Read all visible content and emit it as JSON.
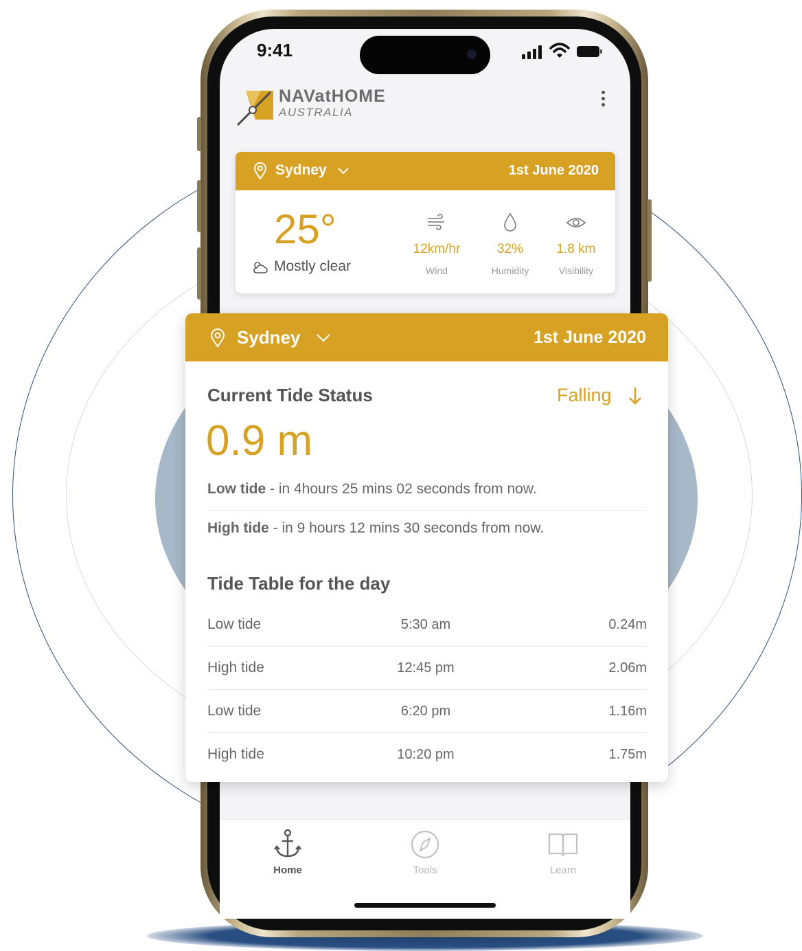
{
  "status_bar": {
    "time": "9:41"
  },
  "brand": {
    "name": "NAVatHOME",
    "subtitle": "AUSTRALIA"
  },
  "weather_card": {
    "location": "Sydney",
    "date": "1st June 2020",
    "temperature": "25°",
    "condition": "Mostly clear",
    "stats": [
      {
        "icon": "wind-icon",
        "value": "12km/hr",
        "label": "Wind"
      },
      {
        "icon": "droplet-icon",
        "value": "32%",
        "label": "Humidity"
      },
      {
        "icon": "eye-icon",
        "value": "1.8 km",
        "label": "Visibility"
      }
    ]
  },
  "tide_card": {
    "location": "Sydney",
    "date": "1st June 2020",
    "status_title": "Current Tide Status",
    "trend": "Falling",
    "current_height": "0.9 m",
    "next_low": {
      "label": "Low tide",
      "text": " - in 4hours 25 mins 02 seconds from now."
    },
    "next_high": {
      "label": "High tide",
      "text": " - in 9 hours 12 mins 30 seconds from now."
    },
    "table_title": "Tide Table for the day",
    "table": [
      {
        "type": "Low tide",
        "time": "5:30 am",
        "height": "0.24m"
      },
      {
        "type": "High tide",
        "time": "12:45 pm",
        "height": "2.06m"
      },
      {
        "type": "Low tide",
        "time": "6:20 pm",
        "height": "1.16m"
      },
      {
        "type": "High tide",
        "time": "10:20 pm",
        "height": "1.75m"
      }
    ]
  },
  "bottom_nav": {
    "tabs": [
      {
        "label": "Home",
        "icon": "anchor-icon",
        "active": true
      },
      {
        "label": "Tools",
        "icon": "compass-icon",
        "active": false
      },
      {
        "label": "Learn",
        "icon": "book-icon",
        "active": false
      }
    ]
  },
  "colors": {
    "accent": "#d7a224",
    "ring": "#2d4f78",
    "disc": "#a7b8c8"
  }
}
